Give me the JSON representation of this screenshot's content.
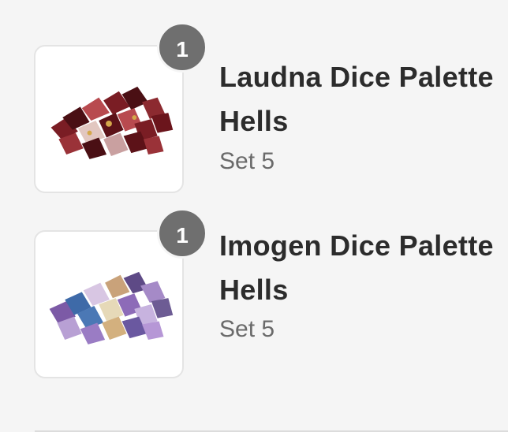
{
  "items": [
    {
      "name_line1": "Laudna Dice Palette",
      "name_line2": "Hells",
      "variant": "Set 5",
      "quantity": "1",
      "image_icon": "red-dice-set-image",
      "colors": [
        "#7a1d24",
        "#4a0f14",
        "#b84a4f",
        "#e2c7c0"
      ]
    },
    {
      "name_line1": "Imogen Dice Palette",
      "name_line2": "Hells",
      "variant": "Set 5",
      "quantity": "1",
      "image_icon": "purple-dice-set-image",
      "colors": [
        "#7c5aa6",
        "#3e6aa8",
        "#d8c6e3",
        "#c9a27a"
      ]
    }
  ]
}
